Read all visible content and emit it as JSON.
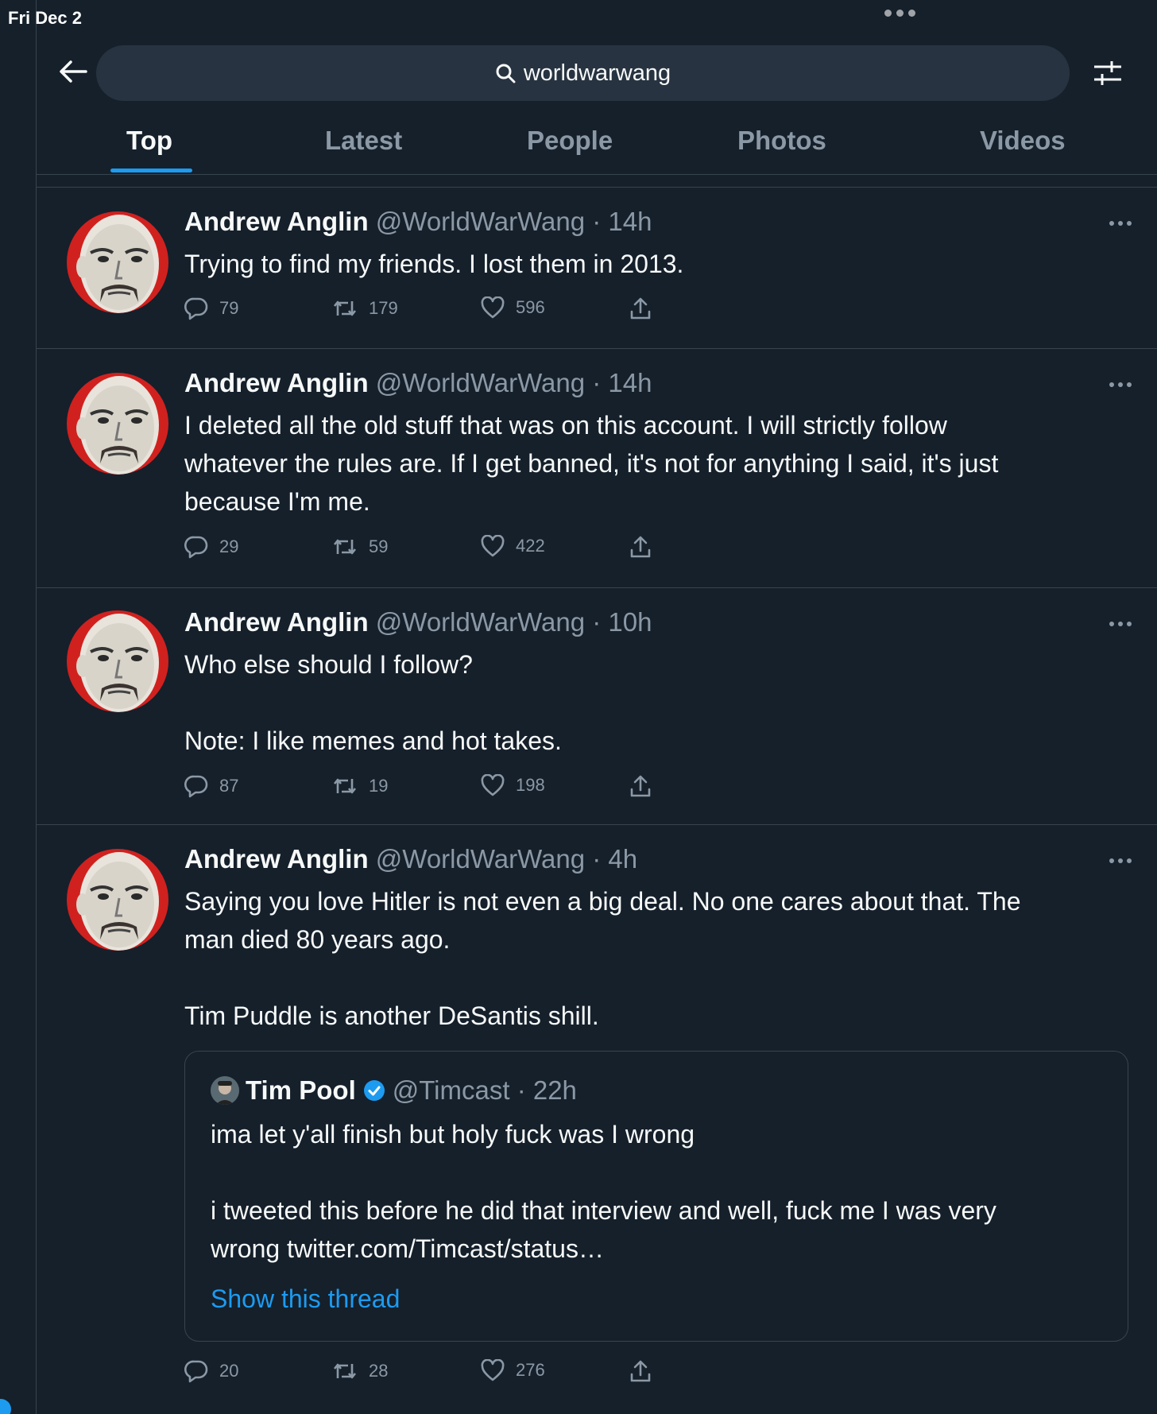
{
  "status_bar": {
    "time": "Fri Dec 2"
  },
  "search": {
    "query": "worldwarwang"
  },
  "tabs": [
    {
      "label": "Top"
    },
    {
      "label": "Latest"
    },
    {
      "label": "People"
    },
    {
      "label": "Photos"
    },
    {
      "label": "Videos"
    }
  ],
  "icons": {
    "back": "arrow-left-icon",
    "search": "search-icon",
    "filter": "sliders-icon",
    "reply": "reply-icon",
    "retweet": "retweet-icon",
    "like": "heart-icon",
    "share": "share-icon",
    "more": "more-icon",
    "verified": "verified-badge-icon"
  },
  "colors": {
    "background": "#15202b",
    "accent": "#1d9bf0",
    "muted": "#8b98a5",
    "avatar_ring": "#e0242a"
  },
  "tweets": [
    {
      "name": "Andrew Anglin",
      "meta": "@WorldWarWang · 14h",
      "lines": [
        "Trying to find my friends. I lost them in 2013."
      ],
      "replies": "79",
      "retweets": "179",
      "likes": "596"
    },
    {
      "name": "Andrew Anglin",
      "meta": "@WorldWarWang · 14h",
      "lines": [
        "I deleted all the old stuff that was on this account. I will strictly follow",
        "whatever the rules are. If I get banned, it's not for anything I said, it's just",
        "because I'm me."
      ],
      "replies": "29",
      "retweets": "59",
      "likes": "422"
    },
    {
      "name": "Andrew Anglin",
      "meta": "@WorldWarWang · 10h",
      "lines": [
        "Who else should I follow?",
        "",
        "Note: I like memes and hot takes."
      ],
      "replies": "87",
      "retweets": "19",
      "likes": "198"
    },
    {
      "name": "Andrew Anglin",
      "meta": "@WorldWarWang · 4h",
      "lines": [
        "Saying you love Hitler is not even a big deal. No one cares about that. The",
        "man died 80 years ago.",
        "",
        "Tim Puddle is another DeSantis shill."
      ],
      "replies": "20",
      "retweets": "28",
      "likes": "276",
      "quote": {
        "name": "Tim Pool",
        "meta": "@Timcast · 22h",
        "lines": [
          "ima let y'all finish but holy fuck was I wrong",
          "",
          "i tweeted this before he did that interview and well, fuck me I was very",
          "wrong twitter.com/Timcast/status…"
        ],
        "link": "Show this thread"
      }
    }
  ]
}
